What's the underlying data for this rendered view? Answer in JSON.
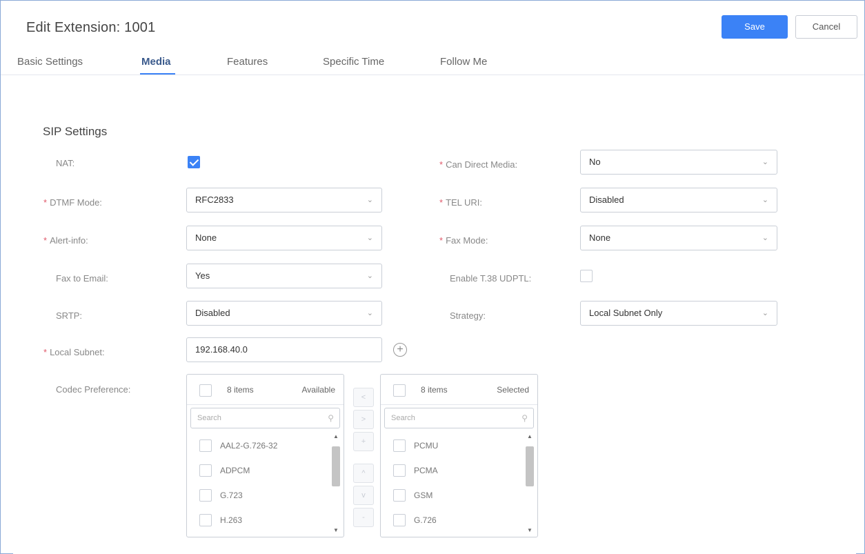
{
  "header": {
    "title": "Edit Extension: 1001",
    "save_label": "Save",
    "cancel_label": "Cancel"
  },
  "tabs": [
    {
      "label": "Basic Settings"
    },
    {
      "label": "Media",
      "active": true
    },
    {
      "label": "Features"
    },
    {
      "label": "Specific Time"
    },
    {
      "label": "Follow Me"
    }
  ],
  "section": {
    "title": "SIP Settings"
  },
  "fields": {
    "nat": {
      "label": "NAT:",
      "checked": true
    },
    "can_direct_media": {
      "label": "Can Direct Media:",
      "value": "No",
      "required": true
    },
    "dtmf_mode": {
      "label": "DTMF Mode:",
      "value": "RFC2833",
      "required": true
    },
    "tel_uri": {
      "label": "TEL URI:",
      "value": "Disabled",
      "required": true
    },
    "alert_info": {
      "label": "Alert-info:",
      "value": "None",
      "required": true
    },
    "fax_mode": {
      "label": "Fax Mode:",
      "value": "None",
      "required": true
    },
    "fax_to_email": {
      "label": "Fax to Email:",
      "value": "Yes"
    },
    "enable_t38": {
      "label": "Enable T.38 UDPTL:",
      "checked": false
    },
    "srtp": {
      "label": "SRTP:",
      "value": "Disabled"
    },
    "strategy": {
      "label": "Strategy:",
      "value": "Local Subnet Only"
    },
    "local_subnet": {
      "label": "Local Subnet:",
      "value": "192.168.40.0",
      "required": true
    },
    "codec_preference": {
      "label": "Codec Preference:"
    }
  },
  "codecs": {
    "available": {
      "count": "8 items",
      "kind": "Available",
      "search_placeholder": "Search",
      "items": [
        "AAL2-G.726-32",
        "ADPCM",
        "G.723",
        "H.263"
      ]
    },
    "selected": {
      "count": "8 items",
      "kind": "Selected",
      "search_placeholder": "Search",
      "items": [
        "PCMU",
        "PCMA",
        "GSM",
        "G.726"
      ]
    },
    "transfer_buttons": [
      "<",
      ">",
      "+",
      "^",
      "v",
      "-"
    ]
  },
  "colors": {
    "accent": "#3b82f6",
    "required": "#e05a6b",
    "border": "#c9ced6"
  }
}
